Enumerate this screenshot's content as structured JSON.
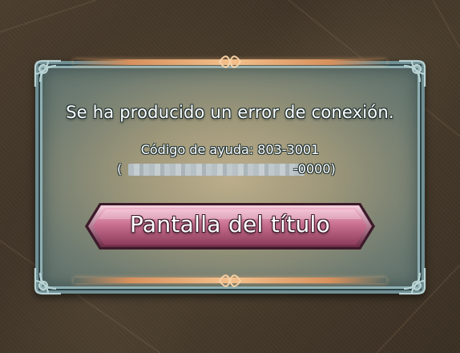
{
  "dialog": {
    "message": "Se ha producido un error de conexión.",
    "help_code": "Código de ayuda: 803-3001",
    "code_paren_open": "(",
    "code_suffix": "-0000)",
    "button_label": "Pantalla del título"
  },
  "colors": {
    "frame": "#6f8f94",
    "accent_bar": "#f3c08c",
    "button": "#c9708f",
    "background": "#463a2b"
  },
  "icons": {
    "corner": "celtic-knot-corner-icon",
    "divider": "celtic-knot-divider-icon"
  }
}
